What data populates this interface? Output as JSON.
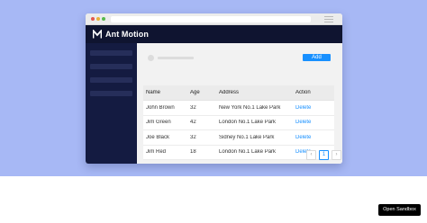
{
  "app": {
    "title": "Ant Motion"
  },
  "toolbar": {
    "add_label": "Add"
  },
  "table": {
    "columns": [
      "Name",
      "Age",
      "Address",
      "Action"
    ],
    "rows": [
      {
        "name": "John Brown",
        "age": "32",
        "address": "New York No.1 Lake Park",
        "action": "Delete"
      },
      {
        "name": "Jim Green",
        "age": "42",
        "address": "London No.1 Lake Park",
        "action": "Delete"
      },
      {
        "name": "Joe Black",
        "age": "32",
        "address": "Sidney No.1 Lake Park",
        "action": "Delete"
      },
      {
        "name": "Jim Red",
        "age": "18",
        "address": "London No.1 Lake Park",
        "action": "Delete"
      }
    ]
  },
  "pagination": {
    "prev": "‹",
    "current": "1",
    "next": "›"
  },
  "sandbox": {
    "label": "Open Sandbox"
  },
  "colors": {
    "accent": "#1890ff",
    "header": "#0f1430",
    "sider": "#141b41",
    "backdrop": "#a7b8f5"
  },
  "icons": {
    "logo": "ant-motion-logo",
    "menu": "hamburger-icon"
  }
}
